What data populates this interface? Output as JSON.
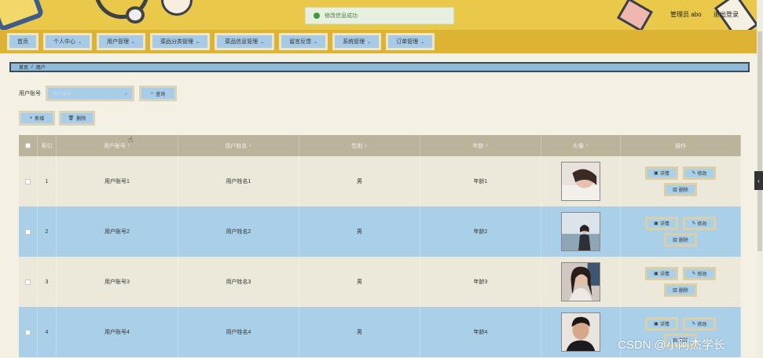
{
  "toast": {
    "text": "修改信息成功"
  },
  "header": {
    "admin_label": "管理员 abo",
    "logout_label": "退出登录"
  },
  "nav": {
    "items": [
      {
        "label": "首页",
        "has_menu": false
      },
      {
        "label": "个人中心",
        "has_menu": true
      },
      {
        "label": "用户管理",
        "has_menu": true
      },
      {
        "label": "菜品分类管理",
        "has_menu": true
      },
      {
        "label": "菜品信息管理",
        "has_menu": true
      },
      {
        "label": "留言反馈",
        "has_menu": true
      },
      {
        "label": "系统管理",
        "has_menu": true
      },
      {
        "label": "订单管理",
        "has_menu": true
      }
    ]
  },
  "breadcrumb": {
    "home": "首页",
    "sep": "/",
    "current": "用户"
  },
  "search": {
    "label": "用户账号",
    "placeholder": "用户账号",
    "query_label": "查询"
  },
  "actions": {
    "add_label": "新增",
    "delete_label": "删除"
  },
  "table": {
    "headers": {
      "index": "索引",
      "account": "用户账号",
      "name": "用户姓名",
      "gender": "性别",
      "age": "年龄",
      "avatar": "头像",
      "ops": "操作"
    },
    "rows": [
      {
        "index": "1",
        "account": "用户账号1",
        "name": "用户姓名1",
        "gender": "男",
        "age": "年龄1"
      },
      {
        "index": "2",
        "account": "用户账号2",
        "name": "用户姓名2",
        "gender": "男",
        "age": "年龄2"
      },
      {
        "index": "3",
        "account": "用户账号3",
        "name": "用户姓名3",
        "gender": "男",
        "age": "年龄3"
      },
      {
        "index": "4",
        "account": "用户账号4",
        "name": "用户姓名4",
        "gender": "男",
        "age": "年龄4"
      }
    ],
    "op_labels": {
      "detail": "详情",
      "edit": "修改",
      "delete": "删除"
    }
  },
  "watermark": "CSDN @小阿杰学长",
  "colors": {
    "header_bg": "#e9c84a",
    "nav_bg": "#dcb332",
    "button_blue": "#a8cde8",
    "row_alt": "#a9d0e8",
    "thead": "#b9b49a"
  }
}
